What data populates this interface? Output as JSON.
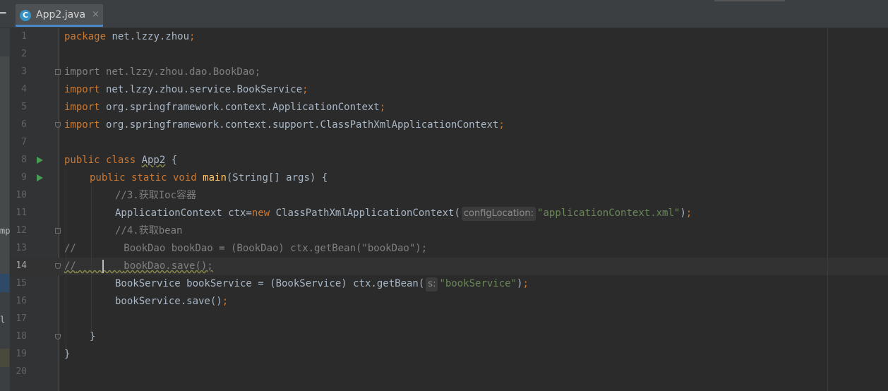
{
  "tab": {
    "label": "App2.java",
    "icon": "c-class-icon",
    "close_glyph": "×"
  },
  "left_strip": {
    "t1": "mp",
    "t2": "l"
  },
  "line_numbers": [
    "1",
    "2",
    "3",
    "4",
    "5",
    "6",
    "7",
    "8",
    "9",
    "10",
    "11",
    "12",
    "13",
    "14",
    "15",
    "16",
    "17",
    "18",
    "19",
    "20"
  ],
  "current_line": "14",
  "code": {
    "l1": {
      "kw": "package",
      "rest": " net.lzzy.zhou",
      "semi": ";"
    },
    "l3": {
      "text": "import net.lzzy.zhou.dao.BookDao;"
    },
    "l4": {
      "kw": "import",
      "rest": " net.lzzy.zhou.service.BookService",
      "semi": ";"
    },
    "l5": {
      "kw": "import",
      "rest": " org.springframework.context.ApplicationContext",
      "semi": ";"
    },
    "l6": {
      "kw": "import",
      "rest": " org.springframework.context.support.ClassPathXmlApplicationContext",
      "semi": ";"
    },
    "l8": {
      "kw": "public class ",
      "name": "App2",
      "rest": " {"
    },
    "l9": {
      "kw": "public static void ",
      "fn": "main",
      "rest": "(String[] args) {"
    },
    "l10": {
      "comment": "//3.获取Ioc容器"
    },
    "l11": {
      "a": "ApplicationContext ctx=",
      "kw": "new",
      "b": " ClassPathXmlApplicationContext(",
      "hint": "configLocation:",
      "str": "\"applicationContext.xml\"",
      "c": ")",
      "semi": ";"
    },
    "l12": {
      "comment": "//4.获取bean"
    },
    "l13": {
      "comment": "//        BookDao bookDao = (BookDao) ctx.getBean(\"bookDao\");"
    },
    "l14": {
      "prefix": "//",
      "mid": "        ",
      "under": "bookDao.save();"
    },
    "l15": {
      "a": "BookService bookService = (BookService) ctx.getBean(",
      "hint": "s:",
      "str": "\"bookService\"",
      "c": ")",
      "semi": ";"
    },
    "l16": {
      "a": "bookService.save()",
      "semi": ";"
    },
    "l18": {
      "text": "}"
    },
    "l19": {
      "text": "}"
    }
  }
}
